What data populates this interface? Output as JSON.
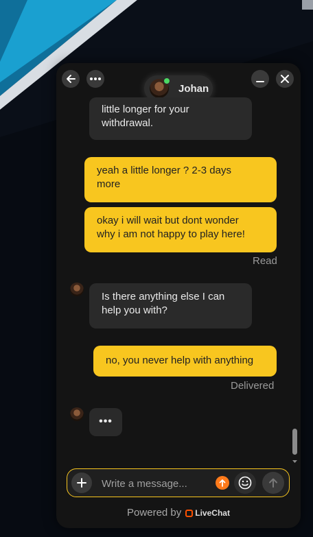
{
  "agent": {
    "name": "Johan"
  },
  "messages": [
    {
      "from": "agent",
      "lines": [
        "little longer for your",
        "withdrawal."
      ]
    },
    {
      "from": "user",
      "lines": [
        "yeah a little longer ? 2-3 days",
        "more"
      ]
    },
    {
      "from": "user",
      "lines": [
        "okay i will wait but dont wonder",
        "why i am not happy to play here!"
      ]
    },
    {
      "from": "agent",
      "lines": [
        "Is there anything else I can",
        "help you with?"
      ]
    },
    {
      "from": "user",
      "lines": [
        "no, you never help with anything"
      ]
    }
  ],
  "status": {
    "read": "Read",
    "delivered": "Delivered"
  },
  "typing": "•••",
  "composer": {
    "placeholder": "Write a message..."
  },
  "footer": {
    "powered_by": "Powered by",
    "brand": "LiveChat"
  },
  "colors": {
    "accent": "#f8c61f",
    "agent_bubble": "#2a2a2a",
    "panel": "#141414",
    "online": "#4cd964",
    "upload": "#ff7a1a"
  }
}
